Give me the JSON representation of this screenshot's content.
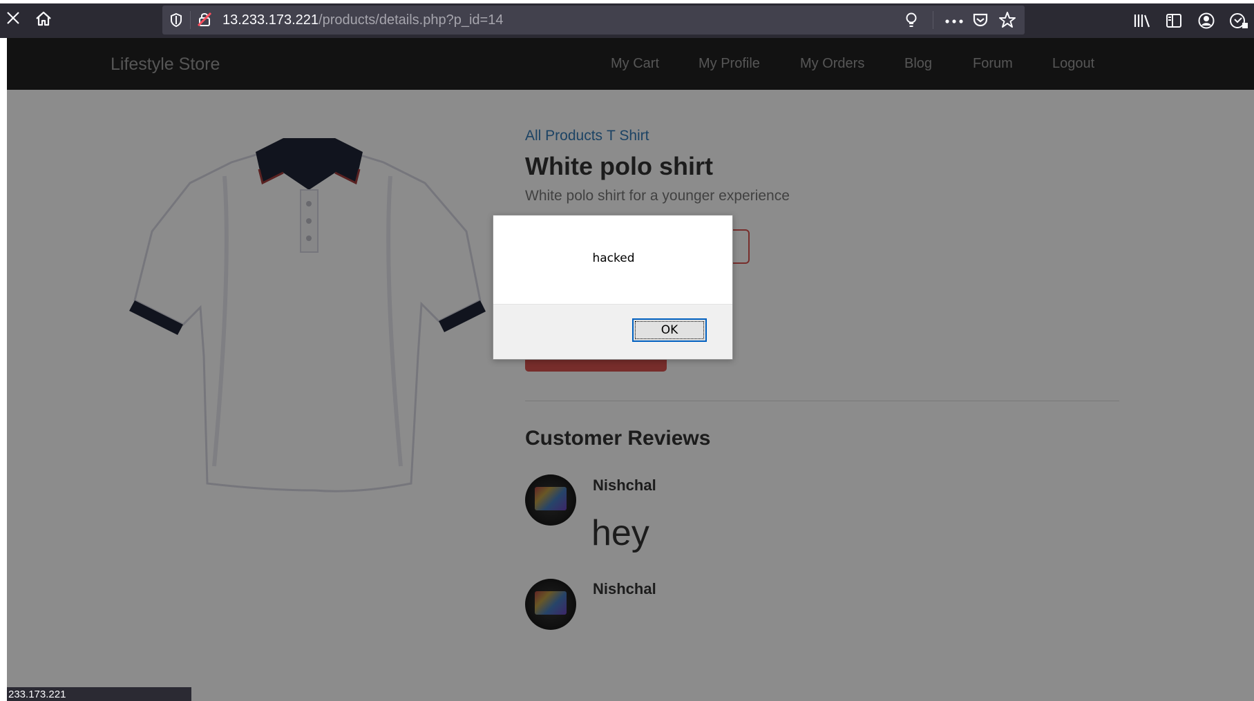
{
  "browser": {
    "url_host": "13.233.173.221",
    "url_path": "/products/details.php?p_id=14"
  },
  "navbar": {
    "brand": "Lifestyle Store",
    "items": [
      "My Cart",
      "My Profile",
      "My Orders",
      "Blog",
      "Forum",
      "Logout"
    ]
  },
  "product": {
    "breadcrumb": [
      "All Products",
      "T Shirt"
    ],
    "title": "White polo shirt",
    "description": "White polo shirt for a younger experience"
  },
  "reviews": {
    "heading": "Customer Reviews",
    "items": [
      {
        "name": "Nishchal",
        "text": "hey"
      },
      {
        "name": "Nishchal",
        "text": ""
      }
    ]
  },
  "alert": {
    "message": "hacked",
    "ok_label": "OK"
  },
  "status_bar": {
    "text": "233.173.221"
  },
  "colors": {
    "navbar_bg": "#222222",
    "link": "#337ab7",
    "danger": "#d9534f",
    "browser_chrome": "#2b2a33"
  }
}
